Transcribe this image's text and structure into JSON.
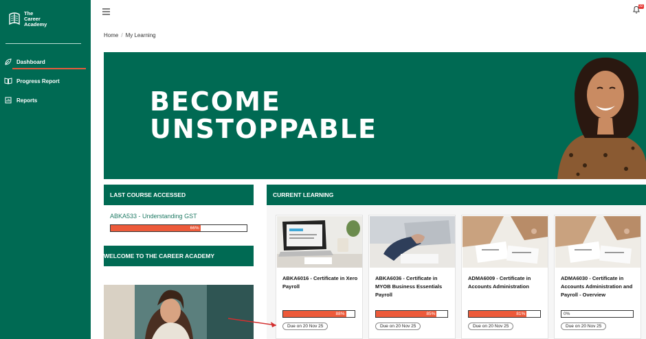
{
  "brand": {
    "name_line1": "The",
    "name_line2": "Career",
    "name_line3": "Academy",
    "color": "#006a53",
    "accent": "#ea5a3c"
  },
  "sidebar": {
    "items": [
      {
        "label": "Dashboard",
        "icon": "leaf-icon",
        "active": true
      },
      {
        "label": "Progress Report",
        "icon": "book-icon",
        "active": false
      },
      {
        "label": "Reports",
        "icon": "chart-icon",
        "active": false
      }
    ]
  },
  "topbar": {
    "menu_icon": "hamburger-icon",
    "notifications_count": "32"
  },
  "breadcrumb": {
    "home": "Home",
    "sep": "/",
    "current": "My Learning"
  },
  "hero": {
    "line1": "BECOME",
    "line2": "UNSTOPPABLE"
  },
  "last_course": {
    "header": "LAST COURSE ACCESSED",
    "course": "ABKA533 - Understanding GST",
    "progress_label": "66%",
    "progress": 0.66
  },
  "welcome": {
    "header": "WELCOME TO THE CAREER ACADEMY"
  },
  "current_learning": {
    "header": "CURRENT LEARNING",
    "cards": [
      {
        "title": "ABKA6016 - Certificate in Xero Payroll",
        "progress_label": "88%",
        "progress": 0.88,
        "due": "Due on 20 Nov 25"
      },
      {
        "title": "ABKA6036 - Certificate in MYOB Business Essentials Payroll",
        "progress_label": "85%",
        "progress": 0.85,
        "due": "Due on 20 Nov 25"
      },
      {
        "title": "ADMA6009 - Certificate in Accounts Administration",
        "progress_label": "81%",
        "progress": 0.81,
        "due": "Due on 20 Nov 25"
      },
      {
        "title": "ADMA6030 - Certificate in Accounts Administration and Payroll - Overview",
        "progress_label": "0%",
        "progress": 0,
        "due": "Due on 20 Nov 25"
      }
    ]
  }
}
